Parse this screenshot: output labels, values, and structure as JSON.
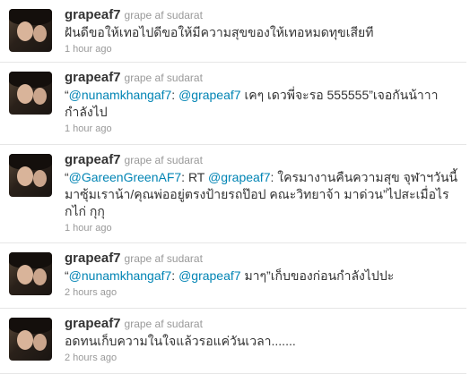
{
  "tweets": [
    {
      "screen_name": "grapeaf7",
      "full_name": "grape af sudarat",
      "parts": [
        {
          "text": "ฝันดีขอให้เทอไปดีขอให้มีความสุขของให้เทอหมดทุขเสียที",
          "mention": false
        }
      ],
      "time": "1 hour ago"
    },
    {
      "screen_name": "grapeaf7",
      "full_name": "grape af sudarat",
      "parts": [
        {
          "text": "“",
          "mention": false
        },
        {
          "text": "@nunamkhangaf7",
          "mention": true
        },
        {
          "text": ": ",
          "mention": false
        },
        {
          "text": "@grapeaf7",
          "mention": true
        },
        {
          "text": " เคๆ เดวพี่จะรอ 555555”เจอกันน้าาากำลังไป",
          "mention": false
        }
      ],
      "time": "1 hour ago"
    },
    {
      "screen_name": "grapeaf7",
      "full_name": "grape af sudarat",
      "parts": [
        {
          "text": "“",
          "mention": false
        },
        {
          "text": "@GareenGreenAF7",
          "mention": true
        },
        {
          "text": ": RT ",
          "mention": false
        },
        {
          "text": "@grapeaf7",
          "mention": true
        },
        {
          "text": ": ใครมางานคืนความสุข จุฬาฯวันนี้ มาซุ้มเราน้า/คุณพ่ออยู่ตรงป้ายรถป๊อป คณะวิทยาจ้า มาด่วน”ไปสะเมื่อไร กไก่ กุกุ",
          "mention": false
        }
      ],
      "time": "1 hour ago"
    },
    {
      "screen_name": "grapeaf7",
      "full_name": "grape af sudarat",
      "parts": [
        {
          "text": "“",
          "mention": false
        },
        {
          "text": "@nunamkhangaf7",
          "mention": true
        },
        {
          "text": ": ",
          "mention": false
        },
        {
          "text": "@grapeaf7",
          "mention": true
        },
        {
          "text": " มาๆ”เก็บของก่อนกำลังไปปะ",
          "mention": false
        }
      ],
      "time": "2 hours ago"
    },
    {
      "screen_name": "grapeaf7",
      "full_name": "grape af sudarat",
      "parts": [
        {
          "text": "อดทนเก็บความในใจแล้วรอแค่วันเวลา.......",
          "mention": false
        }
      ],
      "time": "2 hours ago"
    }
  ]
}
